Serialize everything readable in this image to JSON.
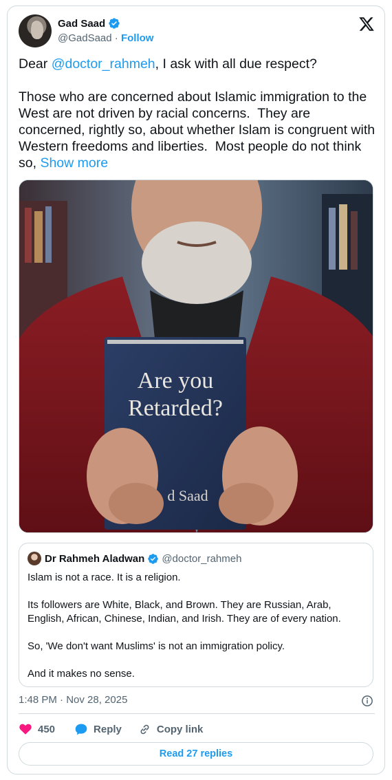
{
  "author": {
    "display_name": "Gad Saad",
    "handle": "@GadSaad",
    "separator": " · ",
    "follow_label": "Follow"
  },
  "tweet": {
    "text_before_mention": "Dear ",
    "mention": "@doctor_rahmeh",
    "text_after_mention": ", I ask with all due respect?\n\nThose who are concerned about Islamic immigration to the West are not driven by racial concerns.  They are concerned, rightly so, about whether Islam is congruent with Western freedoms and liberties.  Most people do not think so, ",
    "show_more": "Show more"
  },
  "photo": {
    "book_line1": "Are you",
    "book_line2": "Retarded?",
    "book_author": "d Saad"
  },
  "quoted_tweet": {
    "display_name": "Dr Rahmeh Aladwan",
    "handle": "@doctor_rahmeh",
    "paragraphs": [
      "Islam is not a race. It is a religion.",
      "Its followers are White, Black, and Brown. They are Russian, Arab, English, African, Chinese, Indian, and Irish. They are of every nation.",
      "So, 'We don't want Muslims' is not an immigration policy.",
      "And it makes no sense."
    ]
  },
  "meta": {
    "timestamp": "1:48 PM · Nov 28, 2025"
  },
  "actions": {
    "likes": "450",
    "reply_label": "Reply",
    "copy_label": "Copy link",
    "read_replies": "Read 27 replies"
  },
  "colors": {
    "accent": "#1d9bf0",
    "like": "#f91880",
    "secondary_text": "#536471",
    "border": "#cfd9de"
  },
  "icons": [
    "verified-badge-icon",
    "x-logo-icon",
    "info-icon",
    "heart-icon",
    "reply-bubble-icon",
    "link-icon"
  ]
}
